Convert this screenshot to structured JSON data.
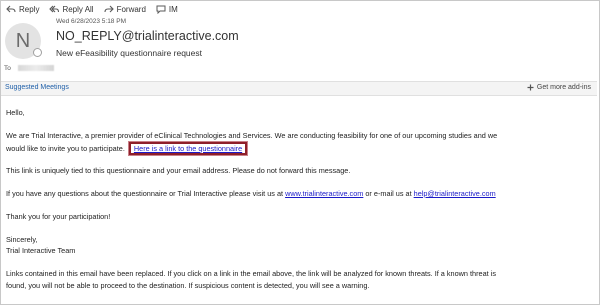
{
  "toolbar": {
    "reply": "Reply",
    "reply_all": "Reply All",
    "forward": "Forward",
    "im": "IM"
  },
  "header": {
    "date": "Wed 6/28/2023 5:18 PM",
    "avatar_initial": "N",
    "sender": "NO_REPLY@trialinteractive.com",
    "subject": "New eFeasibility questionnaire request",
    "to_label": "To"
  },
  "addins": {
    "suggested": "Suggested Meetings",
    "get_more": "Get more add-ins"
  },
  "body": {
    "greeting": "Hello,",
    "p1_line1": "We are Trial Interactive, a premier provider of eClinical Technologies and Services. We are conducting feasibility for one of our upcoming studies and we",
    "p1_line2": "would like to invite you to participate.",
    "questionnaire_link": "Here is a link to the questionnaire",
    "p2": "This link is uniquely tied to this questionnaire and your email address. Please do not forward this message.",
    "p3_pre": "If you have any questions about the questionnaire or Trial Interactive please visit us at",
    "website_link": "www.trialinteractive.com",
    "p3_mid": "or e-mail us at",
    "email_link": "help@trialinteractive.com",
    "thanks": "Thank you for your participation!",
    "sincerely": "Sincerely,",
    "team": "Trial Interactive Team",
    "warn_line1": "Links contained in this email have been replaced. If you click on a link in the email above, the link will be analyzed for known threats. If a known threat is",
    "warn_line2": "found, you will not be able to proceed to the destination. If suspicious content is detected, you will see a warning."
  }
}
